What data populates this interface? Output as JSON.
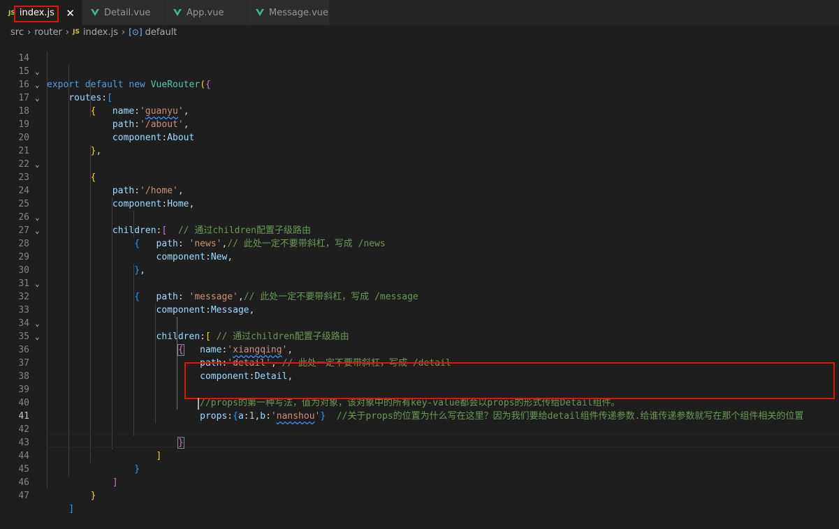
{
  "tabs": [
    {
      "label": "index.js",
      "icon": "js-file-icon",
      "icon_text": "JS",
      "active": true,
      "close": "✕"
    },
    {
      "label": "Detail.vue",
      "icon": "vue-file-icon"
    },
    {
      "label": "App.vue",
      "icon": "vue-file-icon"
    },
    {
      "label": "Message.vue",
      "icon": "vue-file-icon"
    }
  ],
  "breadcrumb": {
    "items": [
      "src",
      "router",
      "index.js",
      "default"
    ],
    "file_icon_text": "JS",
    "symbol_icon": "symbol-module-icon",
    "symbol_icon_text": "[⊙]",
    "separator": "›"
  },
  "editor": {
    "current_line": 41,
    "lines": [
      {
        "n": "14",
        "fold": "⌄",
        "code": "export default new VueRouter({"
      },
      {
        "n": "15",
        "fold": "⌄",
        "code": "routes:["
      },
      {
        "n": "16",
        "fold": "⌄",
        "code": "{"
      },
      {
        "n": "17",
        "code": "name:'guanyu',"
      },
      {
        "n": "18",
        "code": "path:'/about',"
      },
      {
        "n": "19",
        "code": "component:About"
      },
      {
        "n": "20",
        "code": "},"
      },
      {
        "n": "21",
        "fold": "⌄",
        "code": "{"
      },
      {
        "n": "22",
        "code": ""
      },
      {
        "n": "23",
        "code": "path:'/home',"
      },
      {
        "n": "24",
        "code": "component:Home,"
      },
      {
        "n": "25",
        "fold": "⌄",
        "code": "children:[  // 通过children配置子级路由"
      },
      {
        "n": "26",
        "fold": "⌄",
        "code": "{"
      },
      {
        "n": "27",
        "code": "path: 'news',// 此处一定不要带斜杠，写成 /news"
      },
      {
        "n": "28",
        "code": "component:New,"
      },
      {
        "n": "29",
        "code": "},"
      },
      {
        "n": "30",
        "fold": "⌄",
        "code": "{"
      },
      {
        "n": "31",
        "code": "path: 'message',// 此处一定不要带斜杠，写成 /message"
      },
      {
        "n": "32",
        "code": "component:Message,"
      },
      {
        "n": "33",
        "fold": "⌄",
        "code": "children:[ // 通过children配置子级路由"
      },
      {
        "n": "34",
        "fold": "⌄",
        "code": "{"
      },
      {
        "n": "35",
        "code": "name:'xiangqing',"
      },
      {
        "n": "36",
        "code": "path:'detail', // 此处一定不要带斜杠，写成 /detail"
      },
      {
        "n": "37",
        "code": "component:Detail,"
      },
      {
        "n": "38",
        "code": ""
      },
      {
        "n": "39",
        "code": "//props的第一种写法，值为对象，该对象中的所有key-value都会以props的形式传给Detail组件。"
      },
      {
        "n": "40",
        "code": "props:{a:1,b:'nanshou'}  //关于props的位置为什么写在这里？因为我们要给detail组件传递参数.给谁传递参数就写在那个组件相关的位置"
      },
      {
        "n": "41",
        "code": ""
      },
      {
        "n": "42",
        "code": "}"
      },
      {
        "n": "43",
        "code": "]"
      },
      {
        "n": "44",
        "code": "}"
      },
      {
        "n": "45",
        "code": "]"
      },
      {
        "n": "46",
        "code": "}"
      },
      {
        "n": "47",
        "code": "]"
      }
    ]
  },
  "colors": {
    "background": "#1e1e1e",
    "keyword": "#569cd6",
    "string": "#ce9178",
    "property": "#9cdcfe",
    "comment": "#6a9955",
    "highlight_box": "#e51400"
  }
}
